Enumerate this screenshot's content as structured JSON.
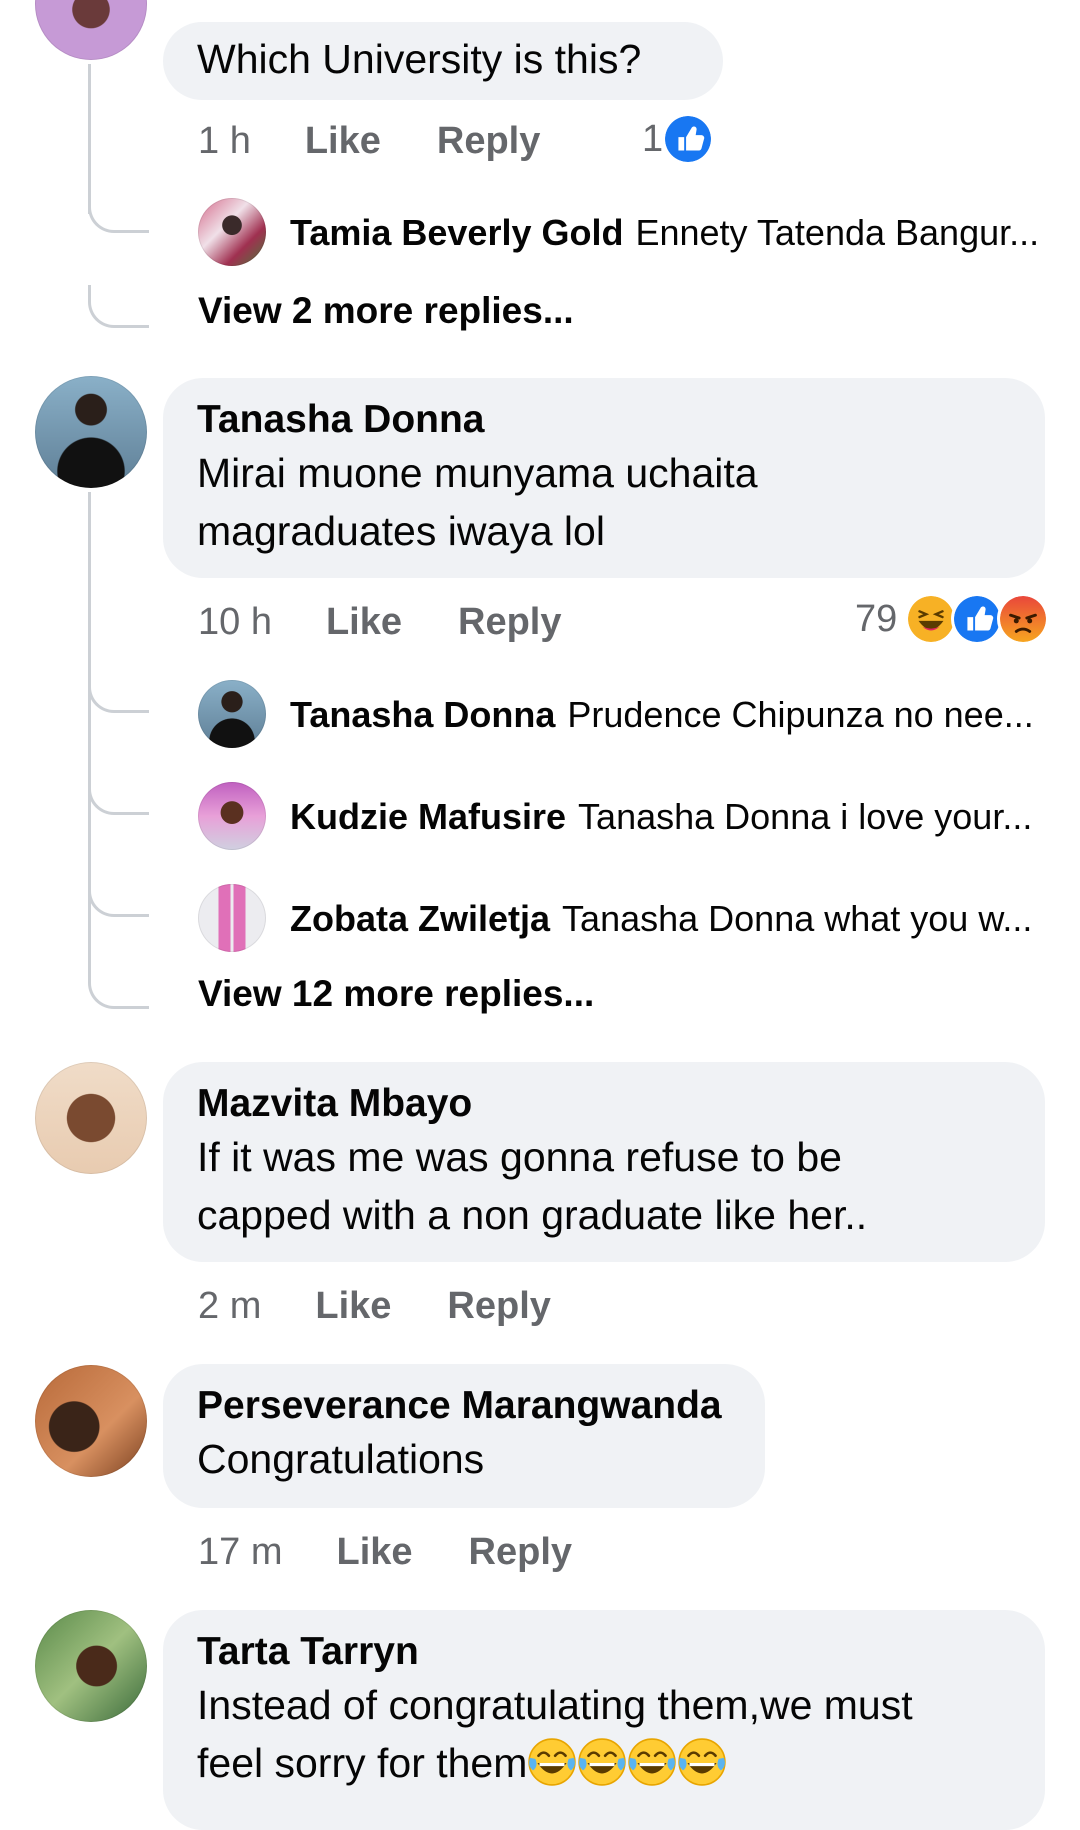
{
  "comments": [
    {
      "text": "Which University is this?",
      "time": "1 h",
      "like": "Like",
      "reply": "Reply",
      "reaction_count": "1",
      "reactions": [
        "like-icon"
      ],
      "replies": [
        {
          "name": "Tamia Beverly Gold",
          "text": "Ennety Tatenda Bangur..."
        }
      ],
      "view_more": "View 2 more replies..."
    },
    {
      "name": "Tanasha Donna",
      "text": "Mirai muone munyama uchaita\nmagraduates iwaya lol",
      "time": "10 h",
      "like": "Like",
      "reply": "Reply",
      "reaction_count": "79",
      "reactions": [
        "haha-icon",
        "like-icon",
        "angry-icon"
      ],
      "replies": [
        {
          "name": "Tanasha Donna",
          "text": "Prudence Chipunza no nee..."
        },
        {
          "name": "Kudzie Mafusire",
          "text": "Tanasha Donna i love your..."
        },
        {
          "name": "Zobata Zwiletja",
          "text": "Tanasha Donna what you w..."
        }
      ],
      "view_more": "View 12 more replies..."
    },
    {
      "name": "Mazvita Mbayo",
      "text": "If it was me was gonna refuse to be\ncapped with a non graduate   like her..",
      "time": "2 m",
      "like": "Like",
      "reply": "Reply"
    },
    {
      "name": "Perseverance Marangwanda",
      "text": "Congratulations",
      "time": "17 m",
      "like": "Like",
      "reply": "Reply"
    },
    {
      "name": "Tarta Tarryn",
      "text": "Instead of congratulating them,we must\nfeel sorry for them",
      "emoji": [
        "joy-emoji",
        "joy-emoji",
        "joy-emoji",
        "joy-emoji"
      ]
    }
  ],
  "colors": {
    "bubble": "#f0f2f5",
    "meta": "#65676b",
    "like_blue": "#1877f2",
    "haha_yellow": "#f7b125",
    "angry_orange": "#e9710f"
  }
}
